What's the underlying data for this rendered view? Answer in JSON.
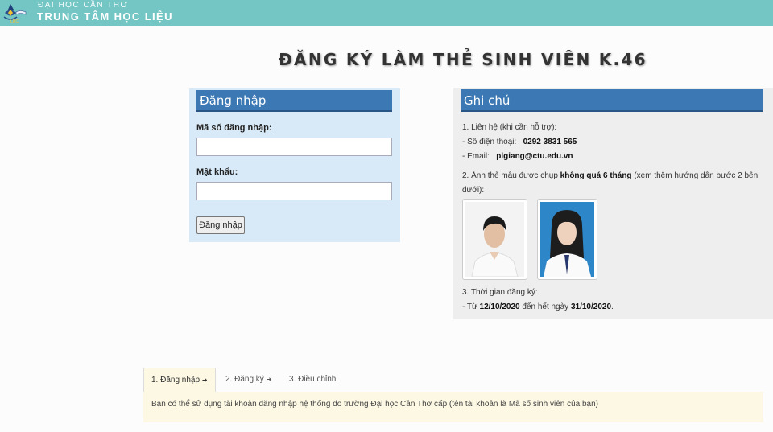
{
  "header": {
    "university": "ĐẠI HỌC CẦN THƠ",
    "center": "TRUNG TÂM HỌC LIỆU",
    "logo_text": "LRC",
    "bg_color": "#74c6c4"
  },
  "title": "ĐĂNG KÝ LÀM THẺ SINH VIÊN K.46",
  "login": {
    "heading": "Đăng nhập",
    "username_label": "Mã số đăng nhập:",
    "username_value": "",
    "password_label": "Mật khẩu:",
    "password_value": "",
    "submit_label": "Đăng nhập"
  },
  "notes": {
    "heading": "Ghi chú",
    "contact_title": "1. Liên hệ (khi cần hỗ trợ):",
    "phone_label": "- Số điện thoại: ",
    "phone_value": "0292 3831 565",
    "email_label": "- Email: ",
    "email_value": "plgiang@ctu.edu.vn",
    "photo_line1_a": "2. Ảnh thẻ mẫu được chụp ",
    "photo_line1_b": "không quá 6 tháng",
    "photo_line1_c": " (xem thêm hướng dẫn bước 2 bên",
    "photo_line2": "dưới):",
    "time_title": "3. Thời gian đăng ký:",
    "time_a": "- Từ ",
    "time_from": "12/10/2020",
    "time_b": " đến hết ngày ",
    "time_to": "31/10/2020",
    "time_c": "."
  },
  "tabs": [
    {
      "label": "1. Đăng nhập",
      "arrow": "➜"
    },
    {
      "label": "2. Đăng ký",
      "arrow": "➜"
    },
    {
      "label": "3. Điều chỉnh",
      "arrow": ""
    }
  ],
  "tab_content": "Bạn có thể sử dụng tài khoản đăng nhập hệ thống do trường Đại học Cần Thơ cấp (tên tài khoản là Mã số sinh viên của bạn)",
  "colors": {
    "panel_header": "#3b78b4",
    "login_bg": "#d8eaf7",
    "notes_bg": "#eeeeee",
    "tab_bg": "#fcf8e3"
  }
}
